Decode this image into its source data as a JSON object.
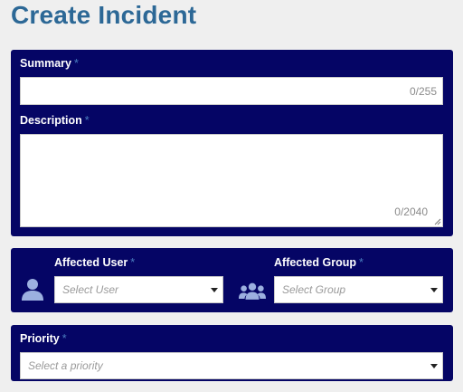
{
  "page": {
    "title": "Create Incident"
  },
  "summary": {
    "label": "Summary",
    "required_mark": "*",
    "value": "",
    "counter": "0/255"
  },
  "description": {
    "label": "Description",
    "required_mark": "*",
    "value": "",
    "counter": "0/2040"
  },
  "affected_user": {
    "label": "Affected User",
    "required_mark": "*",
    "placeholder": "Select User",
    "icon": "user-icon"
  },
  "affected_group": {
    "label": "Affected Group",
    "required_mark": "*",
    "placeholder": "Select Group",
    "icon": "group-icon"
  },
  "priority": {
    "label": "Priority",
    "required_mark": "*",
    "placeholder": "Select a priority"
  },
  "colors": {
    "panel": "#050565",
    "title": "#2c6896",
    "background": "#efefef",
    "required": "#4a7ec0"
  }
}
